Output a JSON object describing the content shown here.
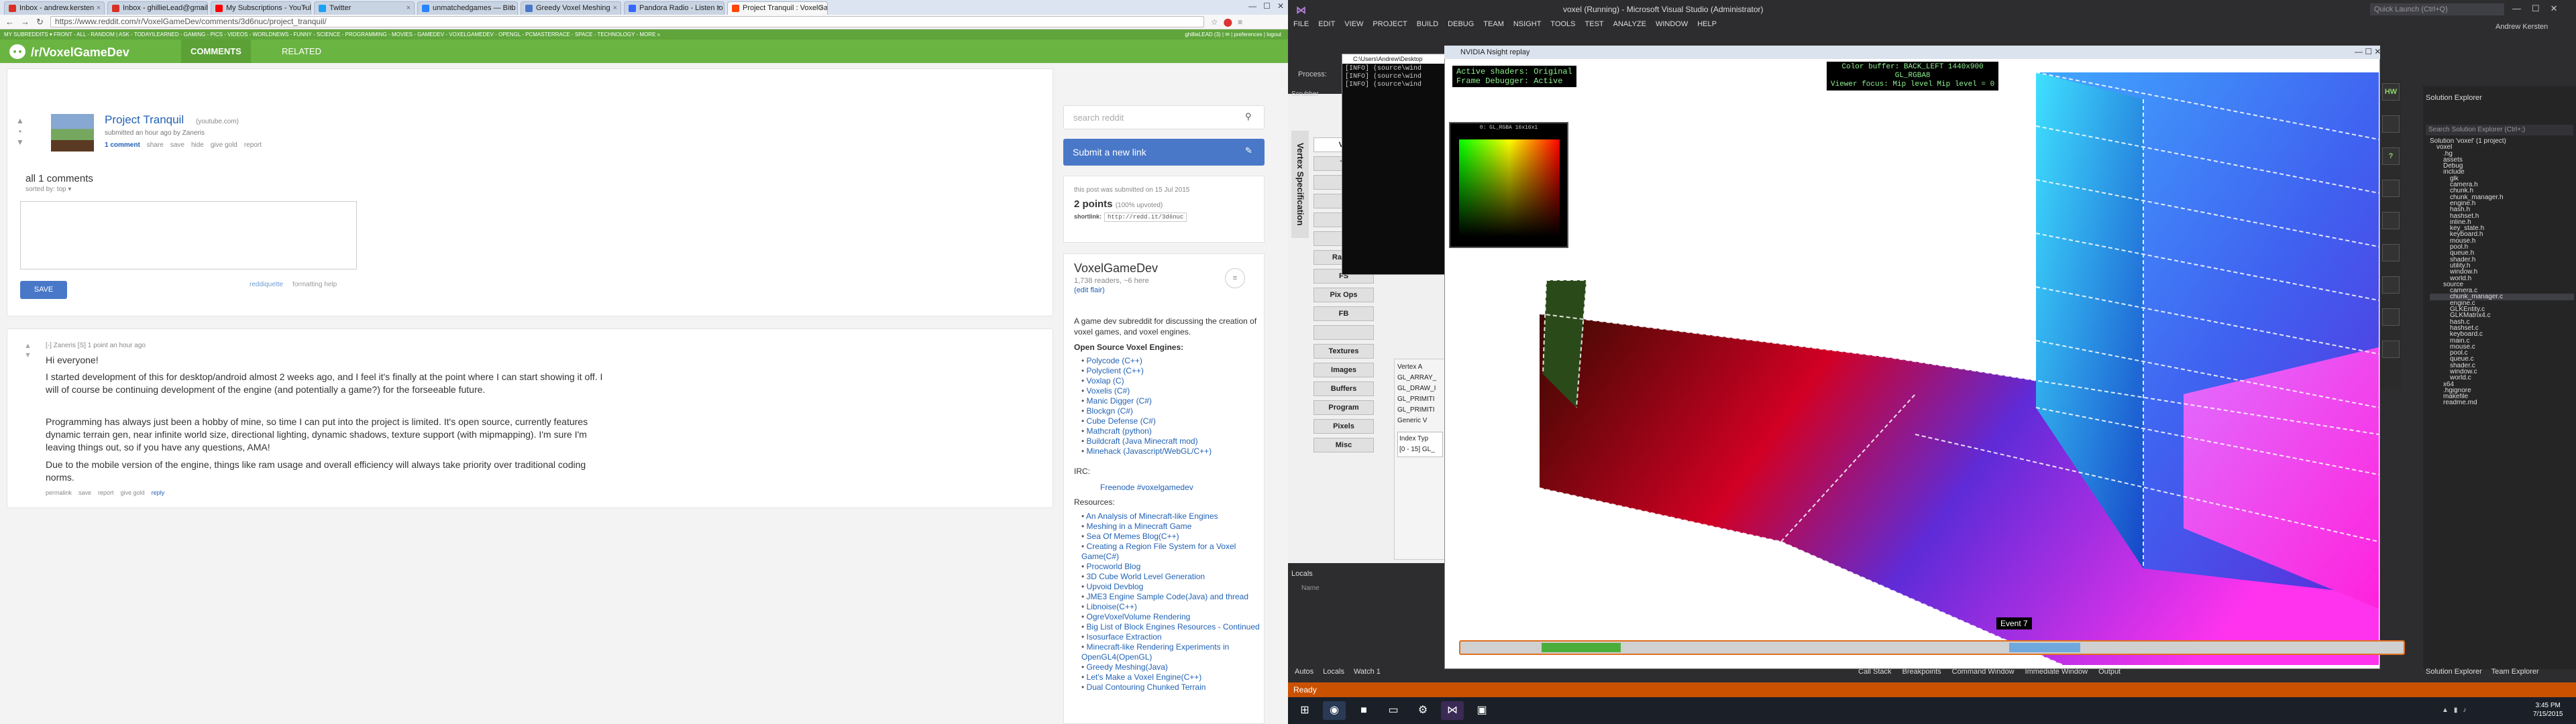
{
  "browser": {
    "tabs": [
      {
        "label": "Inbox - andrew.kersten",
        "color": "#d93025"
      },
      {
        "label": "Inbox - ghillieLead@gmail",
        "color": "#d93025"
      },
      {
        "label": "My Subscriptions - YouTube",
        "color": "#ff0000"
      },
      {
        "label": "Twitter",
        "color": "#1da1f2"
      },
      {
        "label": "unmatchedgames — Bitb",
        "color": "#2684ff"
      },
      {
        "label": "Greedy Voxel Meshing",
        "color": "#4a78c8"
      },
      {
        "label": "Pandora Radio - Listen to",
        "color": "#3668ff"
      },
      {
        "label": "Project Tranquil : VoxelGa",
        "color": "#ff4500"
      }
    ],
    "url": "https://www.reddit.com/r/VoxelGameDev/comments/3d6nuc/project_tranquil/",
    "subreddit_bar": "MY SUBREDDITS ▾ FRONT - ALL - RANDOM | ASK - TODAYILEARNED - GAMING - PICS - VIDEOS - WORLDNEWS - FUNNY - SCIENCE - PROGRAMMING - MOVIES - GAMEDEV - VOXELGAMEDEV - OPENGL - PCMASTERRACE - SPACE - TECHNOLOGY - MORE »",
    "user": "ghillieLEAD (3) | ✉ | preferences | logout",
    "subreddit_name": "/r/VoxelGameDev",
    "tab_comments": "COMMENTS",
    "tab_related": "RELATED"
  },
  "post": {
    "title": "Project Tranquil",
    "domain": "(youtube.com)",
    "submitted": "submitted an hour ago by Zaneris",
    "actions": [
      "1 comment",
      "share",
      "save",
      "hide",
      "give gold",
      "report"
    ],
    "all_comments": "all 1 comments",
    "sorted_by": "sorted by: top ▾",
    "save_label": "SAVE",
    "reddiquette": "reddiquette",
    "formatting_help": "formatting help"
  },
  "comment": {
    "author": "Zaneris",
    "meta": "[-] Zaneris [S] 1 point an hour ago",
    "paragraphs": [
      "Hi everyone!",
      "I started development of this for desktop/android almost 2 weeks ago, and I feel it's finally at the point where I can start showing it off. I will of course be continuing development of the engine (and potentially a game?) for the forseeable future.",
      "Programming has always just been a hobby of mine, so time I can put into the project is limited. It's open source, currently features dynamic terrain gen, near infinite world size, directional lighting, dynamic shadows, texture support (with mipmapping). I'm sure I'm leaving things out, so if you have any questions, AMA!",
      "Due to the mobile version of the engine, things like ram usage and overall efficiency will always take priority over traditional coding norms."
    ],
    "buttons": [
      "permalink",
      "save",
      "report",
      "give gold",
      "reply"
    ]
  },
  "sidebar": {
    "search_placeholder": "search reddit",
    "submit_label": "Submit a new link",
    "submitted_on": "this post was submitted on 15 Jul 2015",
    "points": "2 points",
    "upvoted": "(100% upvoted)",
    "shortlink_label": "shortlink:",
    "shortlink": "http://redd.it/3d6nuc",
    "sub_title": "VoxelGameDev",
    "readers": "1,738 readers, ~6 here",
    "edit_flair": "(edit flair)",
    "description": "A game dev subreddit for discussing the creation of voxel games, and voxel engines.",
    "open_source_heading": "Open Source Voxel Engines:",
    "engines": [
      "Polycode (C++)",
      "Polyclient (C++)",
      "Voxlap (C)",
      "Voxelis (C#)",
      "Manic Digger (C#)",
      "Blockgn (C#)",
      "Cube Defense (C#)",
      "Mathcraft (python)",
      "Buildcraft (Java Minecraft mod)",
      "Minehack (Javascript/WebGL/C++)"
    ],
    "irc_heading": "IRC:",
    "irc": "Freenode #voxelgamedev",
    "resources_heading": "Resources:",
    "resources": [
      "An Analysis of Minecraft-like Engines",
      "Meshing in a Minecraft Game",
      "Sea Of Memes Blog(C++)",
      "Creating a Region File System for a Voxel Game(C#)",
      "Procworld Blog",
      "3D Cube World Level Generation",
      "Upvoid Devblog",
      "JME3 Engine Sample Code(Java) and thread",
      "Libnoise(C++)",
      "OgreVoxelVolume Rendering",
      "Big List of Block Engines Resources - Continued",
      "Isosurface Extraction",
      "Minecraft-like Rendering Experiments in OpenGL4(OpenGL)",
      "Greedy Meshing(Java)",
      "Let's Make a Voxel Engine(C++)",
      "Dual Contouring Chunked Terrain"
    ]
  },
  "vs": {
    "title": "voxel (Running) - Microsoft Visual Studio (Administrator)",
    "quick_launch": "Quick Launch (Ctrl+Q)",
    "menu": [
      "FILE",
      "EDIT",
      "VIEW",
      "PROJECT",
      "BUILD",
      "DEBUG",
      "TEAM",
      "NSIGHT",
      "TOOLS",
      "TEST",
      "ANALYZE",
      "WINDOW",
      "HELP"
    ],
    "user": "Andrew Kersten",
    "process_label": "Process:",
    "scrubber": "Scrubber",
    "vertex_spec": "Vertex Specification",
    "stages": [
      "VS",
      "Tr",
      "",
      "",
      "",
      "",
      "Raster",
      "FS",
      "Pix Ops",
      "FB",
      "",
      "Textures",
      "Images",
      "Buffers",
      "Program",
      "Pixels",
      "Misc"
    ],
    "cmd_title": "C:\\Users\\Andrew\\Desktop",
    "cmd_lines": [
      "[INFO] (source\\wind",
      "[INFO] (source\\wind",
      "[INFO] (source\\wind"
    ],
    "vtx_panel": [
      "Vertex A",
      "GL_ARRAY_",
      "GL_DRAW_I",
      "GL_PRIMITI",
      "GL_PRIMITI",
      "Generic V"
    ],
    "vtx_table": [
      "Index  Typ",
      "[0 - 15]  GL_"
    ],
    "locals": "Locals",
    "locals_name": "Name",
    "bottom_tabs": [
      "Autos",
      "Locals",
      "Watch 1"
    ],
    "bottom_tabs2": [
      "Call Stack",
      "Breakpoints",
      "Command Window",
      "Immediate Window",
      "Output"
    ],
    "status": "Ready",
    "clock_time": "3:45 PM",
    "clock_date": "7/15/2015"
  },
  "nsight": {
    "title": "NVIDIA Nsight replay",
    "overlay_left": [
      "Active shaders: Original",
      "Frame Debugger: Active"
    ],
    "overlay_right": [
      "Color buffer: BACK_LEFT 1440x900",
      "GL_RGBA8",
      "Viewer focus: Mip level Mip level = 0"
    ],
    "swatch_title": "0: GL_RGBA 16x16x1",
    "event_label": "Event 7",
    "hw_buttons": [
      "HW",
      "",
      "?",
      "",
      "",
      "",
      "",
      "",
      ""
    ]
  },
  "solution_explorer": {
    "title": "Solution Explorer",
    "search": "Search Solution Explorer (Ctrl+;)",
    "items": [
      "Solution 'voxel' (1 project)",
      "voxel",
      ".hg",
      "assets",
      "Debug",
      "include",
      "glk",
      "camera.h",
      "chunk.h",
      "chunk_manager.h",
      "engine.h",
      "hash.h",
      "hashset.h",
      "inline.h",
      "key_state.h",
      "keyboard.h",
      "mouse.h",
      "pool.h",
      "queue.h",
      "shader.h",
      "utility.h",
      "window.h",
      "world.h",
      "source",
      "camera.c",
      "chunk_manager.c",
      "engine.c",
      "GLKEntity.c",
      "GLKMatrix4.c",
      "hash.c",
      "hashset.c",
      "keyboard.c",
      "main.c",
      "mouse.c",
      "pool.c",
      "queue.c",
      "shader.c",
      "window.c",
      "world.c",
      "x64",
      ".hgignore",
      "makefile",
      "readme.md"
    ],
    "bottom": [
      "Solution Explorer",
      "Team Explorer"
    ]
  }
}
